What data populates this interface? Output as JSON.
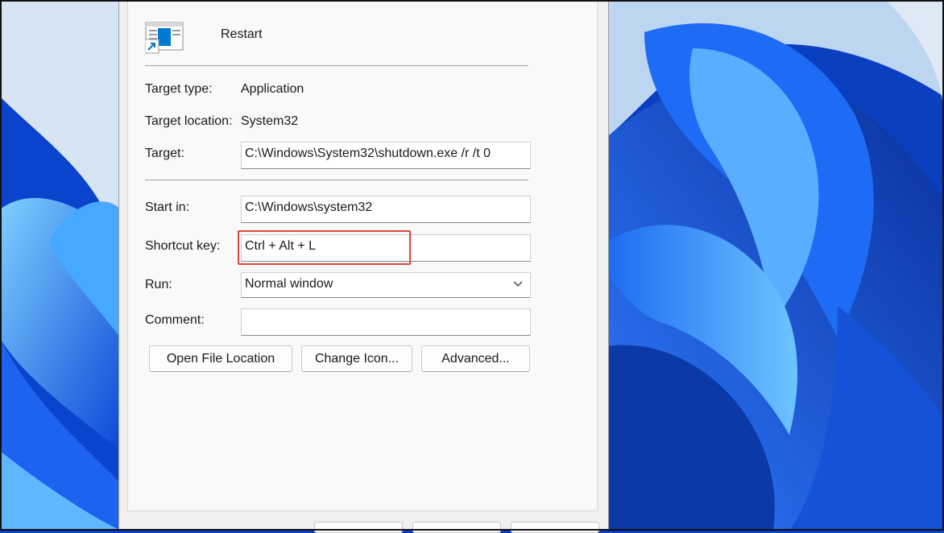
{
  "shortcut": {
    "name": "Restart",
    "icon": "shortcut-app-icon",
    "target_type_label": "Target type:",
    "target_type_value": "Application",
    "target_location_label": "Target location:",
    "target_location_value": "System32",
    "target_label": "Target:",
    "target_value": "C:\\Windows\\System32\\shutdown.exe /r /t 0",
    "start_in_label": "Start in:",
    "start_in_value": "C:\\Windows\\system32",
    "shortcut_key_label": "Shortcut key:",
    "shortcut_key_value": "Ctrl + Alt + L",
    "run_label": "Run:",
    "run_value": "Normal window",
    "comment_label": "Comment:",
    "comment_value": ""
  },
  "buttons": {
    "open_file_location": "Open File Location",
    "change_icon": "Change Icon...",
    "advanced": "Advanced..."
  },
  "colors": {
    "highlight": "#e0463b",
    "accent": "#0078d4",
    "wallpaper": "#0a3fbf"
  }
}
